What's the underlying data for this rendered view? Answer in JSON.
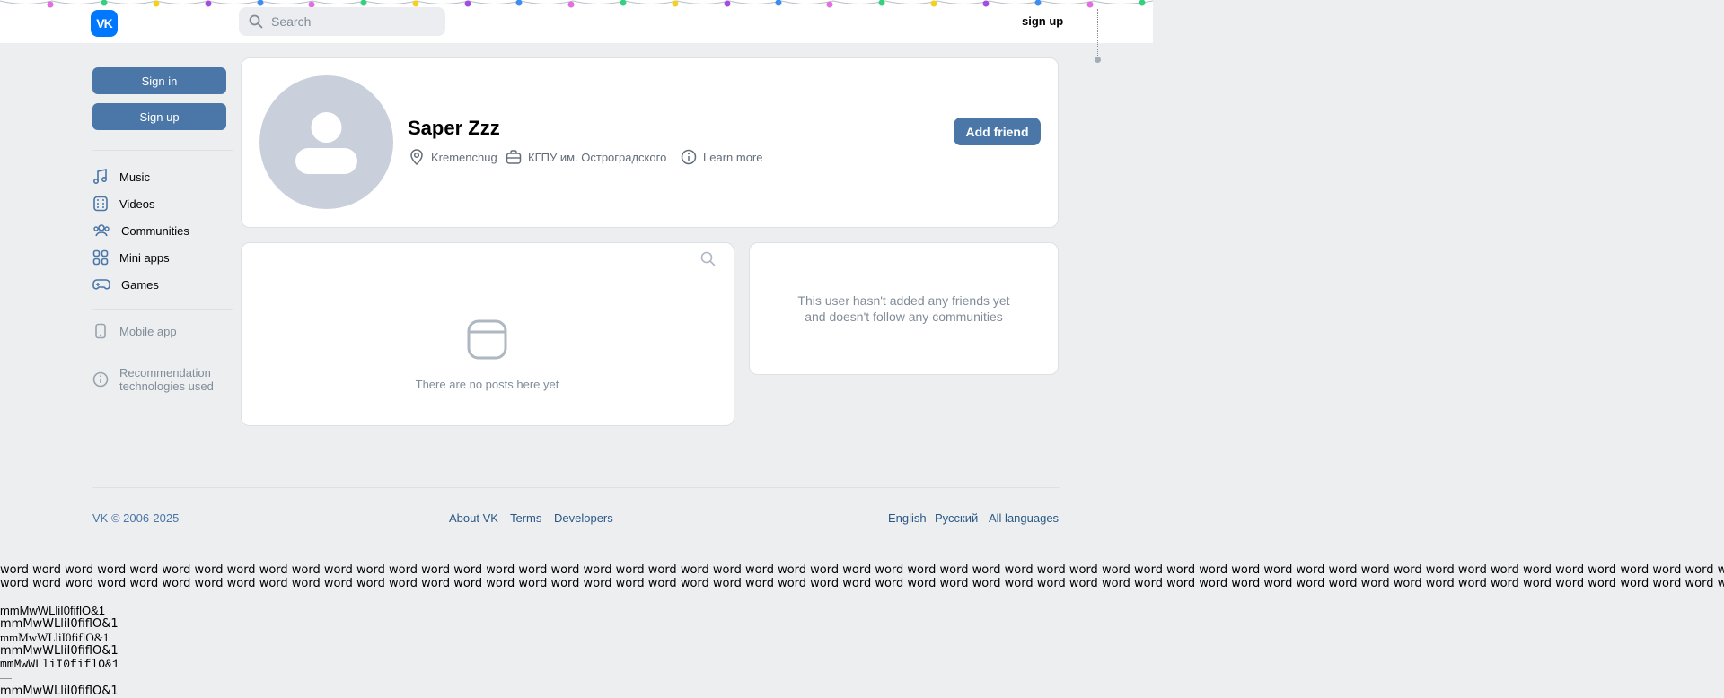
{
  "header": {
    "logo_text": "VK",
    "search_placeholder": "Search",
    "sign_up_link": "sign up"
  },
  "sidebar": {
    "sign_in_button": "Sign in",
    "sign_up_button": "Sign up",
    "items": [
      {
        "label": "Music",
        "icon": "music-icon"
      },
      {
        "label": "Videos",
        "icon": "video-icon"
      },
      {
        "label": "Communities",
        "icon": "communities-icon"
      },
      {
        "label": "Mini apps",
        "icon": "apps-icon"
      },
      {
        "label": "Games",
        "icon": "gamepad-icon"
      }
    ],
    "mobile_app": "Mobile app",
    "recommendation_line1": "Recommendation",
    "recommendation_line2": "technologies used"
  },
  "profile": {
    "name": "Saper Zzz",
    "city": "Kremenchug",
    "university": "КГПУ им. Остроградского",
    "learn_more": "Learn more",
    "add_friend_button": "Add friend"
  },
  "posts": {
    "empty_text": "There are no posts here yet"
  },
  "friends": {
    "empty_line1": "This user hasn't added any friends yet",
    "empty_line2": "and doesn't follow any communities"
  },
  "footer": {
    "copyright": "VK © 2006-2025",
    "links": [
      "About VK",
      "Terms",
      "Developers"
    ],
    "languages": [
      "English",
      "Русский",
      "All languages"
    ]
  },
  "debug_text": {
    "word_line": "word word word word word word word word word word word word word word word word word word word word word word word word word word word word word word word word word word word word word word word word word word word word word word word word word word word word word word word word word word word word word word word word word word word word word word word word word word",
    "font_test": "mmMwWLliI0fiflO&1",
    "dash": "—"
  },
  "colors": {
    "accent": "#4a76a8",
    "brand": "#0077ff",
    "background": "#edeef0"
  }
}
